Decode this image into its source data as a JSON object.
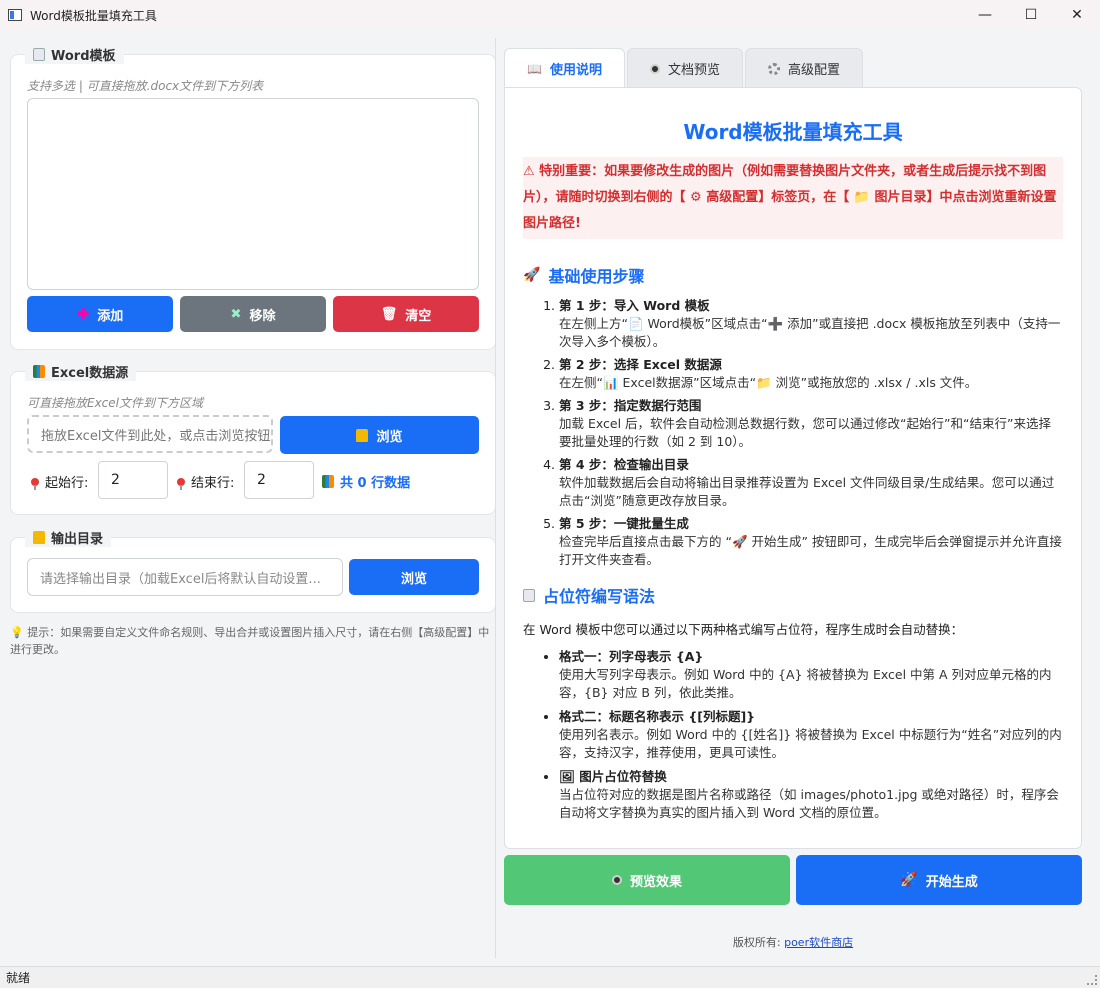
{
  "window": {
    "title": "Word模板批量填充工具",
    "minimize": "—",
    "maximize": "☐",
    "close": "✕"
  },
  "word": {
    "title": "Word模板",
    "hint": "支持多选 | 可直接拖放.docx文件到下方列表",
    "add": "添加",
    "remove": "移除",
    "clear": "清空"
  },
  "excel": {
    "title": "Excel数据源",
    "hint": "可直接拖放Excel文件到下方区域",
    "drop_placeholder": "拖放Excel文件到此处，或点击浏览按钮",
    "browse": "浏览",
    "start_label": "起始行:",
    "start_value": "2",
    "end_label": "结束行:",
    "end_value": "2",
    "count": "共 0 行数据"
  },
  "output": {
    "title": "输出目录",
    "placeholder": "请选择输出目录（加载Excel后将默认自动设置...",
    "browse": "浏览"
  },
  "tip": "提示：如果需要自定义文件命名规则、导出合并或设置图片插入尺寸，请在右侧【高级配置】中进行更改。",
  "tabs": [
    {
      "label": "使用说明"
    },
    {
      "label": "文档预览"
    },
    {
      "label": "高级配置"
    }
  ],
  "doc": {
    "title": "Word模板批量填充工具",
    "warn": "⚠ 特别重要：如果要修改生成的图片（例如需要替换图片文件夹，或者生成后提示找不到图片），请随时切换到右侧的【 ⚙ 高级配置】标签页，在【 📁 图片目录】中点击浏览重新设置图片路径!",
    "section1": "基础使用步骤",
    "steps": [
      {
        "head": "第 1 步：导入 Word 模板",
        "desc": "在左侧上方“📄 Word模板”区域点击“➕ 添加”或直接把 .docx 模板拖放至列表中（支持一次导入多个模板）。"
      },
      {
        "head": "第 2 步：选择 Excel 数据源",
        "desc": "在左侧“📊 Excel数据源”区域点击“📁 浏览”或拖放您的 .xlsx / .xls 文件。"
      },
      {
        "head": "第 3 步：指定数据行范围",
        "desc": "加载 Excel 后，软件会自动检测总数据行数，您可以通过修改“起始行”和“结束行”来选择要批量处理的行数（如 2 到 10）。"
      },
      {
        "head": "第 4 步：检查输出目录",
        "desc": "软件加载数据后会自动将输出目录推荐设置为 Excel 文件同级目录/生成结果。您可以通过点击“浏览”随意更改存放目录。"
      },
      {
        "head": "第 5 步：一键批量生成",
        "desc": "检查完毕后直接点击最下方的 “🚀 开始生成” 按钮即可，生成完毕后会弹窗提示并允许直接打开文件夹查看。"
      }
    ],
    "section2": "占位符编写语法",
    "intro": "在 Word 模板中您可以通过以下两种格式编写占位符，程序生成时会自动替换：",
    "formats": [
      {
        "head": "格式一：列字母表示 {A}",
        "desc": "使用大写列字母表示。例如 Word 中的 {A} 将被替换为 Excel 中第 A 列对应单元格的内容，{B} 对应 B 列，依此类推。"
      },
      {
        "head": "格式二：标题名称表示 {[列标题]}",
        "desc": "使用列名表示。例如 Word 中的 {[姓名]} 将被替换为 Excel 中标题行为“姓名”对应列的内容，支持汉字，推荐使用，更具可读性。"
      },
      {
        "head": "🖼 图片占位符替换",
        "desc": "当占位符对应的数据是图片名称或路径（如 images/photo1.jpg 或绝对路径）时，程序会自动将文字替换为真实的图片插入到 Word 文档的原位置。"
      }
    ]
  },
  "actions": {
    "preview": "预览效果",
    "generate": "开始生成"
  },
  "copyright": {
    "label": "版权所有:",
    "link": "poer软件商店"
  },
  "status": "就绪"
}
